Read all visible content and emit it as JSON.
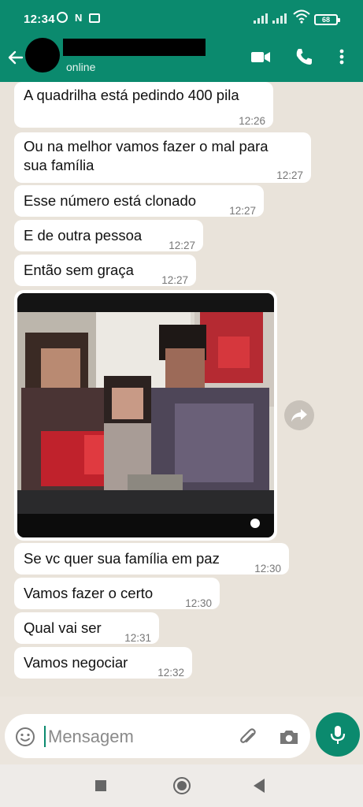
{
  "status_bar": {
    "time": "12:34",
    "battery": "68",
    "icons": [
      "alarm-icon",
      "nfc-icon",
      "message-icon",
      "signal-icon",
      "signal-icon",
      "wifi-icon",
      "battery-icon"
    ]
  },
  "header": {
    "status": "online",
    "icons": [
      "back-arrow-icon",
      "video-call-icon",
      "phone-icon",
      "more-vert-icon"
    ],
    "color": "#0b8a6e"
  },
  "messages": [
    {
      "text": "A quadrilha está pedindo 400 pila",
      "time": "12:26"
    },
    {
      "text_line1": "Ou na melhor vamos fazer o mal para",
      "text_line2": "sua família",
      "time": "12:27"
    },
    {
      "text": "Esse número está clonado",
      "time": "12:27"
    },
    {
      "text": "E de outra pessoa",
      "time": "12:27"
    },
    {
      "text": "Então sem graça",
      "time": "12:27"
    },
    {
      "text": "Se vc quer sua família em paz",
      "time": "12:30"
    },
    {
      "text": "Vamos fazer o certo",
      "time": "12:30"
    },
    {
      "text": "Qual vai ser",
      "time": "12:31"
    },
    {
      "text": "Vamos negociar",
      "time": "12:32"
    }
  ],
  "input": {
    "placeholder": "Mensagem",
    "icons": [
      "emoji-icon",
      "attach-icon",
      "camera-icon",
      "mic-icon"
    ]
  },
  "colors": {
    "accent": "#0b8a6e",
    "chat_background": "#e9e3da",
    "bubble": "#ffffff"
  }
}
